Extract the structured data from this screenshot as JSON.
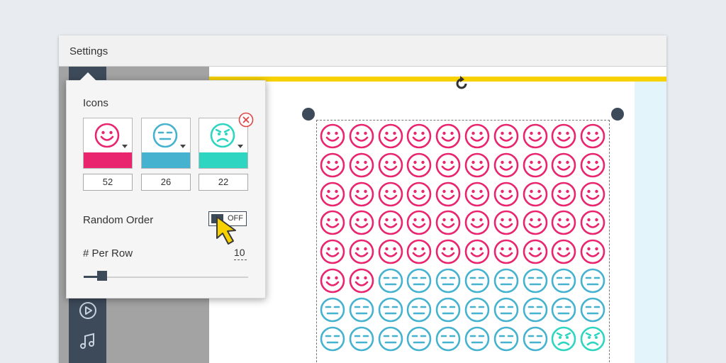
{
  "window": {
    "title": "Settings"
  },
  "colors": {
    "pink": "#e8256e",
    "blue": "#45b3cf",
    "teal": "#2ed6c1",
    "accent_yellow": "#f7d200",
    "dark": "#3d4a5a"
  },
  "sidebar": {
    "icons": [
      "play-icon",
      "music-note-icon"
    ]
  },
  "settings_popup": {
    "heading": "Icons",
    "icons": [
      {
        "face": "happy",
        "color": "#e8256e",
        "count": "52"
      },
      {
        "face": "neutral",
        "color": "#45b3cf",
        "count": "26"
      },
      {
        "face": "angry",
        "color": "#2ed6c1",
        "count": "22"
      }
    ],
    "random_order": {
      "label": "Random Order",
      "state": "OFF"
    },
    "per_row": {
      "label": "# Per Row",
      "value": "10"
    }
  },
  "grid": {
    "columns": 10,
    "visible_rows": 8,
    "counts": {
      "happy": 52,
      "neutral": 26,
      "angry": 22
    }
  }
}
